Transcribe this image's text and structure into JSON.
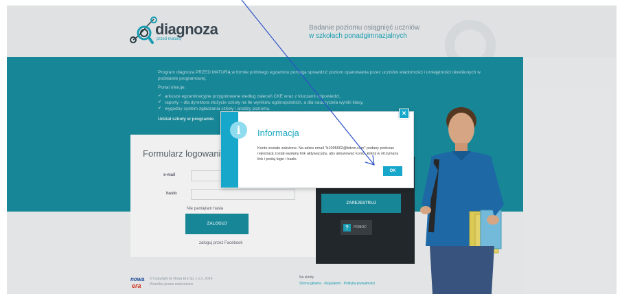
{
  "header": {
    "logo_text": "diagnoza",
    "logo_sub": "przed\nmaturą",
    "tagline_line1": "Badanie poziomu osiągnięć uczniów",
    "tagline_line2": "w szkołach ponadgimnazjalnych"
  },
  "intro": {
    "paragraph": "Program diagnoza PRZED MATURĄ w formie próbnego egzaminu pomaga sprawdzić poziom opanowania przez uczniów wiadomości i umiejętności określonych w podstawie programowej.",
    "offer_heading": "Portal oferuje:",
    "offer_items": [
      "arkusze egzaminacyjne przygotowane według zaleceń CKE wraz z kluczami odpowiedzi,",
      "raporty – dla dyrektora złożycie szkoły na tle wyników ogólnopolskich, a dla nauczyciela wyniki klasy,",
      "wygodny system zgłaszania szkoły i analizy poziomu."
    ],
    "participation": "Udział szkoły w programie"
  },
  "login": {
    "title": "Formularz logowania",
    "email_label": "e-mail",
    "password_label": "hasło",
    "forgot_link": "Nie pamiętam hasła",
    "login_button": "ZALOGUJ",
    "facebook_link": "zaloguj przez Facebook"
  },
  "register": {
    "register_button": "ZAREJESTRUJ",
    "help_button": "POMOC"
  },
  "footer": {
    "logo_text": "nowa era",
    "copyright_line1": "© Copyright by Nowa Era Sp. z o.o. 2014",
    "copyright_line2": "Wszelkie prawa zastrzeżone",
    "social_label": "Na skróty",
    "links": "Strona główna  ·  Regulamin  ·  Polityka prywatności"
  },
  "modal": {
    "title": "Informacja",
    "message": "Konto zostało założone. Na adres email \"b1005602@bitvm.com\" podany podczas rejestracji został wysłany link aktywacyjny, aby aktywować konto, kliknij w otrzymany link i podaj login i hasło.",
    "ok_button": "OK",
    "close_symbol": "×",
    "info_symbol": "i"
  },
  "colors": {
    "brand_teal": "#198fa0",
    "modal_blue": "#16a7cb",
    "annotation_arrow": "#2e52c9"
  },
  "icons": {
    "logo": "magnifier-molecule-icon",
    "info": "info-icon",
    "close": "close-icon",
    "help": "help-icon"
  }
}
